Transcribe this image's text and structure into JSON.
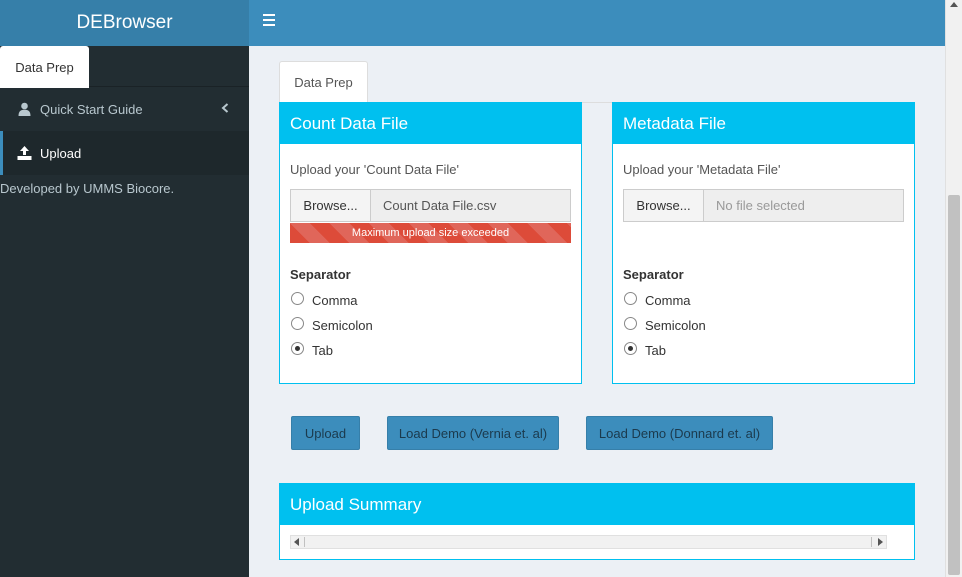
{
  "header": {
    "logo": "DEBrowser",
    "menu_icon": "hamburger-icon"
  },
  "sidebar": {
    "tab": "Data Prep",
    "items": [
      {
        "label": "Quick Start Guide",
        "icon": "user-icon"
      },
      {
        "label": "Upload",
        "icon": "upload-icon"
      }
    ],
    "developed_prefix": "Developed by",
    "developed_link": "UMMS Biocore."
  },
  "main": {
    "tab": "Data Prep",
    "count_box": {
      "title": "Count Data File",
      "upload_label": "Upload your 'Count Data File'",
      "browse": "Browse...",
      "file_name": "Count Data File.csv",
      "error": "Maximum upload size exceeded",
      "separator_title": "Separator",
      "options": [
        "Comma",
        "Semicolon",
        "Tab"
      ],
      "selected": "Tab"
    },
    "meta_box": {
      "title": "Metadata File",
      "upload_label": "Upload your 'Metadata File'",
      "browse": "Browse...",
      "placeholder": "No file selected",
      "separator_title": "Separator",
      "options": [
        "Comma",
        "Semicolon",
        "Tab"
      ],
      "selected": "Tab"
    },
    "buttons": {
      "upload": "Upload",
      "demo_vernia": "Load Demo (Vernia et. al)",
      "demo_donnard": "Load Demo (Donnard et. al)"
    },
    "summary_box": {
      "title": "Upload Summary"
    }
  },
  "colors": {
    "navbar": "#3c8dbc",
    "logo_bg": "#367fa9",
    "sidebar": "#222d32",
    "box_header": "#00c0ef",
    "error": "#dd4b39"
  }
}
